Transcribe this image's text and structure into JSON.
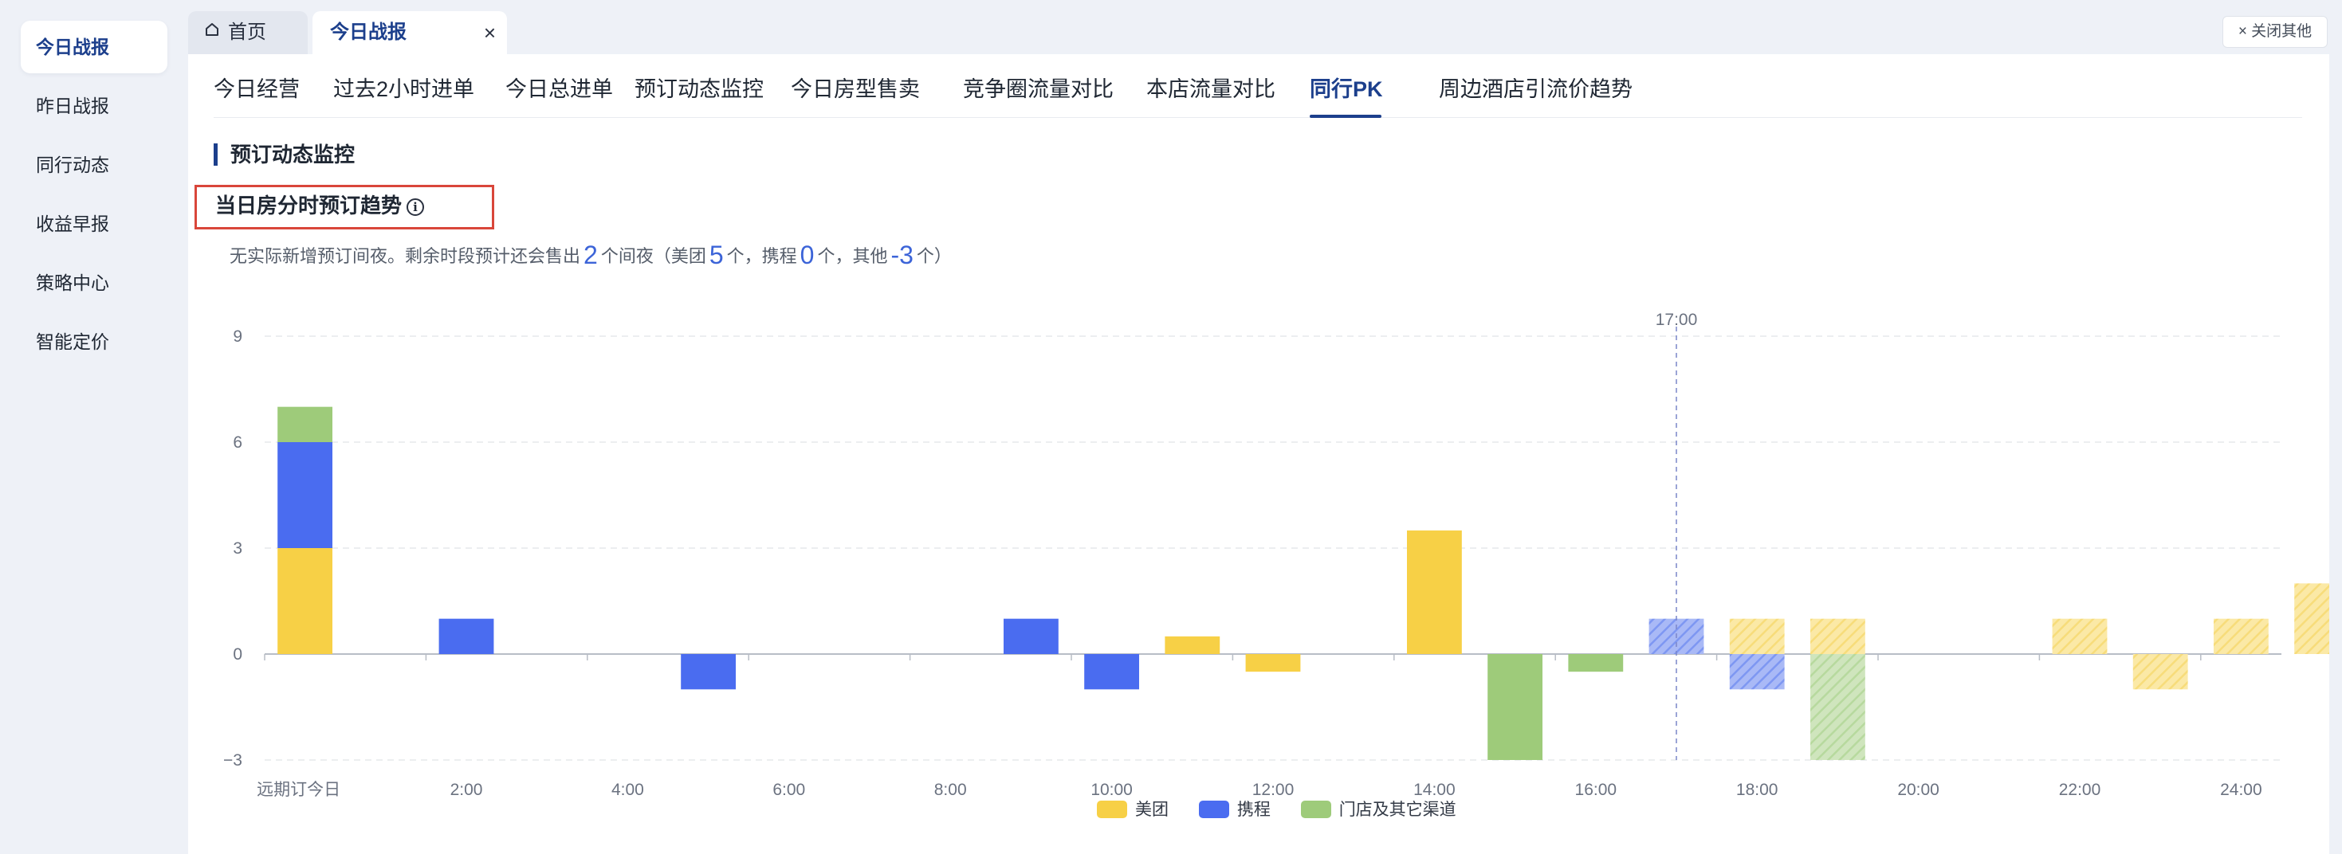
{
  "sidebar": {
    "items": [
      {
        "label": "今日战报",
        "active": true
      },
      {
        "label": "昨日战报",
        "active": false
      },
      {
        "label": "同行动态",
        "active": false
      },
      {
        "label": "收益早报",
        "active": false
      },
      {
        "label": "策略中心",
        "active": false
      },
      {
        "label": "智能定价",
        "active": false
      }
    ]
  },
  "tabs": {
    "home": "首页",
    "current": "今日战报",
    "close_symbol": "×",
    "close_others": "× 关闭其他"
  },
  "subnav": {
    "items": [
      "今日经营",
      "过去2小时进单",
      "今日总进单",
      "预订动态监控",
      "今日房型售卖",
      "竞争圈流量对比",
      "本店流量对比",
      "同行PK",
      "周边酒店引流价趋势"
    ],
    "active_index": 7
  },
  "section": {
    "title": "预订动态监控",
    "chart_title": "当日房分时预订趋势",
    "info_symbol": "i"
  },
  "summary": {
    "prefix": "无实际新增预订间夜。剩余时段预计还会售出",
    "total": "2",
    "seg1": "个间夜（美团",
    "meituan": "5",
    "seg2": "个，携程",
    "ctrip": "0",
    "seg3": "个，其他",
    "other": "-3",
    "seg4": "个）"
  },
  "colors": {
    "meituan": "#f7d046",
    "ctrip": "#4a6cf0",
    "other": "#9ecb7a",
    "accent": "#1c3f8c",
    "highlight": "#d9463a"
  },
  "chart_data": {
    "type": "bar",
    "stacked": true,
    "x_labels": [
      "远期订今日",
      "2:00",
      "4:00",
      "6:00",
      "8:00",
      "10:00",
      "12:00",
      "14:00",
      "16:00",
      "18:00",
      "20:00",
      "22:00",
      "24:00"
    ],
    "slots": 25,
    "now_index": 17,
    "now_label": "17:00",
    "ylim": [
      -3,
      9
    ],
    "yticks": [
      -3,
      0,
      3,
      6,
      9
    ],
    "series": [
      {
        "name": "美团",
        "color": "#f7d046",
        "values": [
          3,
          0,
          0,
          0,
          0,
          0,
          0,
          0,
          0,
          0,
          0,
          0.5,
          -0.5,
          0,
          3.5,
          0,
          0,
          0,
          1,
          1,
          0,
          0,
          1,
          -1,
          1,
          2
        ]
      },
      {
        "name": "携程",
        "color": "#4a6cf0",
        "values": [
          3,
          0,
          1,
          0,
          0,
          -1,
          0,
          0,
          0,
          1,
          -1,
          0,
          0,
          0,
          0,
          0,
          0,
          1,
          -1,
          0,
          0,
          0,
          0,
          0,
          0,
          0
        ]
      },
      {
        "name": "门店及其它渠道",
        "color": "#9ecb7a",
        "values": [
          1,
          0,
          0,
          0,
          0,
          0,
          0,
          0,
          0,
          0,
          0,
          0,
          0,
          0,
          0,
          -3,
          -0.5,
          0,
          0,
          -3,
          0,
          0,
          0,
          0,
          0,
          0
        ]
      }
    ]
  }
}
